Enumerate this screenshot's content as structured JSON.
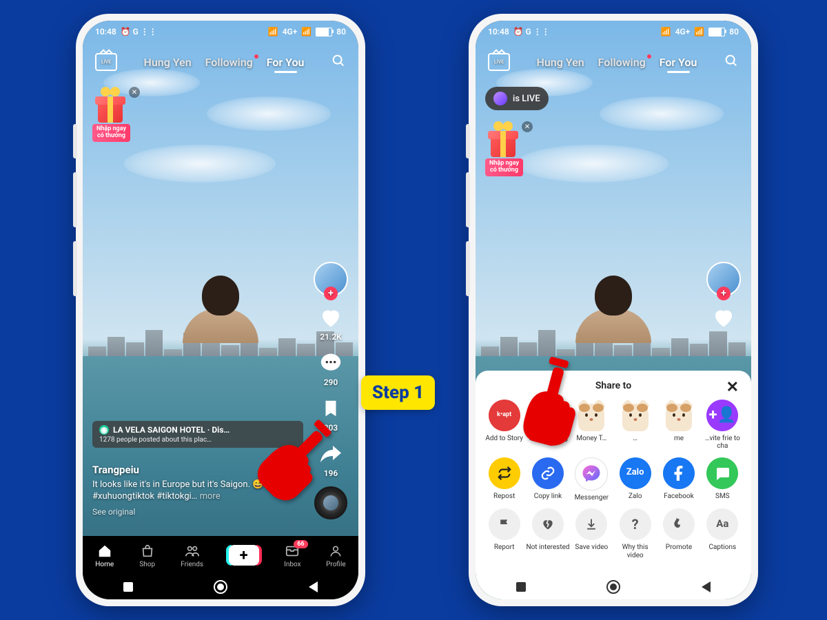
{
  "step_label": "Step 1",
  "status": {
    "time": "10:48",
    "icons_left": "⏰ G ⋮⋮",
    "net": "4G+",
    "battery": "80"
  },
  "top_nav": {
    "live": "LIVE",
    "tabs": [
      "Hung Yen",
      "Following",
      "For You"
    ],
    "active_index": 2
  },
  "gift": {
    "label": "Nhập ngay\ncó thưởng"
  },
  "is_live_text": "is LIVE",
  "location": {
    "title": "LA VELA SAIGON HOTEL · Dis…",
    "subtitle": "1278 people posted about this plac…"
  },
  "caption": {
    "username": "Trangpeiu",
    "text": "It looks like it's in Europe but it's Saigon. 😄 #saigon #xuhuongtiktok #tiktokgi…",
    "more": "more",
    "see_original": "See original"
  },
  "rail": {
    "likes": "21.2K",
    "comments": "290",
    "saves": "803",
    "shares": "196"
  },
  "bottom_nav": {
    "home": "Home",
    "shop": "Shop",
    "friends": "Friends",
    "inbox": "Inbox",
    "inbox_badge": "66",
    "profile": "Profile"
  },
  "share": {
    "title": "Share to",
    "row1": [
      {
        "label": "Add to Story"
      },
      {
        "label": "T… Văn C…ng"
      },
      {
        "label": "Money T…"
      },
      {
        "label": "…"
      },
      {
        "label": "me"
      },
      {
        "label": "…vite frie to cha"
      }
    ],
    "row2": [
      {
        "label": "Repost"
      },
      {
        "label": "Copy link"
      },
      {
        "label": "Messenger"
      },
      {
        "label": "Zalo"
      },
      {
        "label": "Facebook"
      },
      {
        "label": "SMS"
      }
    ],
    "row3": [
      {
        "label": "Report"
      },
      {
        "label": "Not interested"
      },
      {
        "label": "Save video"
      },
      {
        "label": "Why this video"
      },
      {
        "label": "Promote"
      },
      {
        "label": "Captions"
      }
    ]
  }
}
